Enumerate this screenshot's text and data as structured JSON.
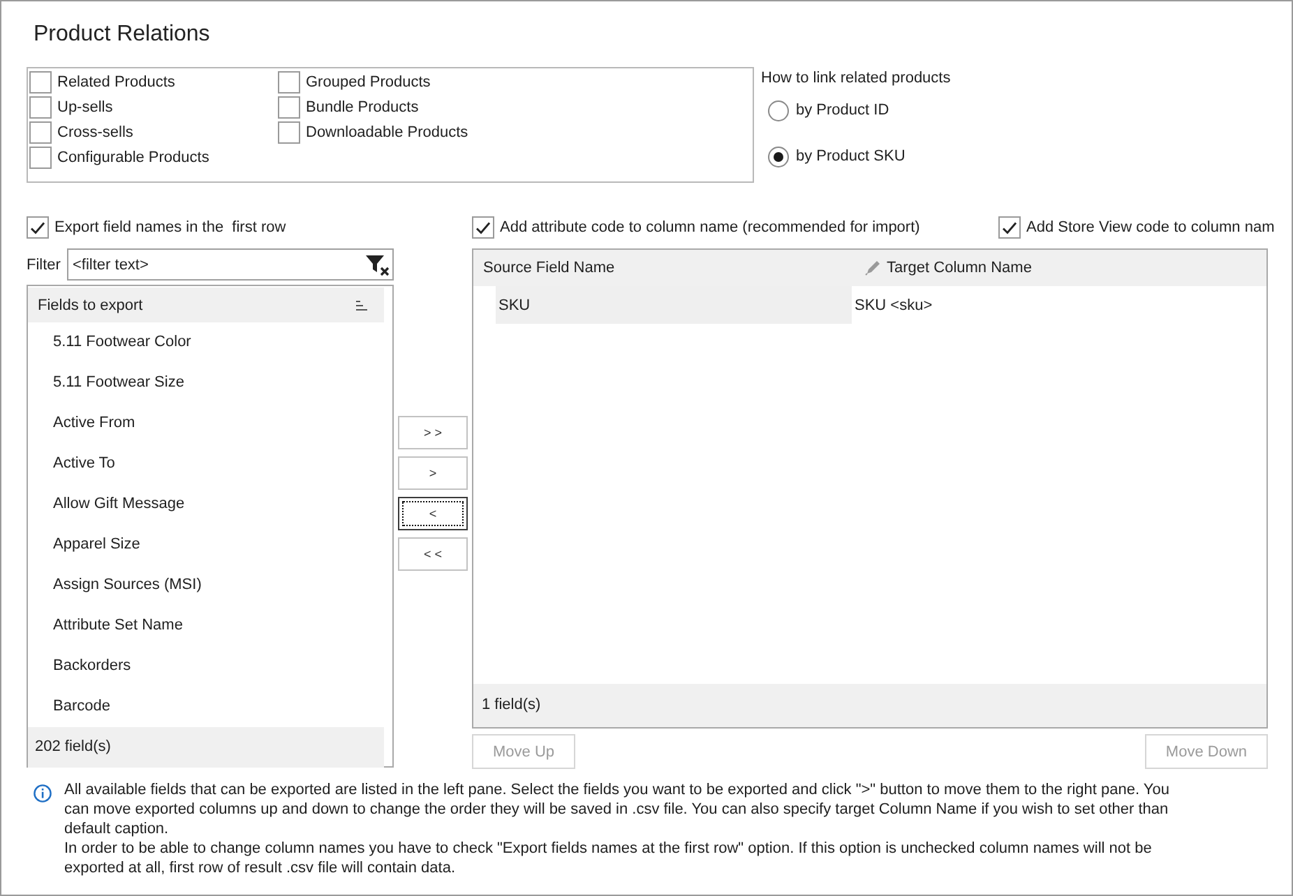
{
  "title": "Product Relations",
  "relation_types": [
    {
      "label": "Related Products",
      "checked": false
    },
    {
      "label": "Up-sells",
      "checked": false
    },
    {
      "label": "Cross-sells",
      "checked": false
    },
    {
      "label": "Configurable Products",
      "checked": false
    },
    {
      "label": "Grouped Products",
      "checked": false
    },
    {
      "label": "Bundle Products",
      "checked": false
    },
    {
      "label": "Downloadable Products",
      "checked": false
    }
  ],
  "link_by": {
    "label": "How to link related products",
    "options": [
      {
        "label": "by Product ID",
        "selected": false
      },
      {
        "label": "by Product SKU",
        "selected": true
      }
    ]
  },
  "left_pane": {
    "export_option": {
      "label": "Export field names in the  first row",
      "checked": true
    },
    "filter": {
      "label": "Filter",
      "placeholder": "<filter text>"
    },
    "list": {
      "header": "Fields to export",
      "items": [
        "5.11 Footwear Color",
        "5.11 Footwear Size",
        "Active From",
        "Active To",
        "Allow Gift Message",
        "Apparel Size",
        "Assign Sources (MSI)",
        "Attribute Set Name",
        "Backorders",
        "Barcode"
      ],
      "footer": "202 field(s)"
    }
  },
  "transfer_buttons": [
    {
      "label": "> >",
      "focused": false
    },
    {
      "label": ">",
      "focused": false
    },
    {
      "label": "<",
      "focused": true
    },
    {
      "label": "< <",
      "focused": false
    }
  ],
  "right_pane": {
    "options": [
      {
        "label": "Add attribute code to column name (recommended for import)",
        "checked": true
      },
      {
        "label": "Add Store View code to column nam",
        "checked": true
      }
    ],
    "grid": {
      "columns": [
        {
          "label": "Source Field Name",
          "editable": false
        },
        {
          "label": "Target Column Name",
          "editable": true
        }
      ],
      "rows": [
        {
          "source": "SKU",
          "target": "SKU <sku>"
        }
      ],
      "footer": "1 field(s)"
    },
    "buttons": [
      {
        "label": "Move Up",
        "disabled": true
      },
      {
        "label": "Move Down",
        "disabled": true
      }
    ]
  },
  "info": {
    "paragraphs": [
      "All available fields that can be exported are listed in the left pane. Select the fields you want to be exported and click \">\" button to move them to the right pane. You can move exported columns up and down to change the order they will be saved in .csv file. You can also specify target Column Name if you wish to set other than default caption.",
      "In order to be able to change column names you have to check \"Export fields names at the first row\" option. If this option is unchecked column names will not be exported at all, first row of result .csv file will contain data."
    ]
  }
}
